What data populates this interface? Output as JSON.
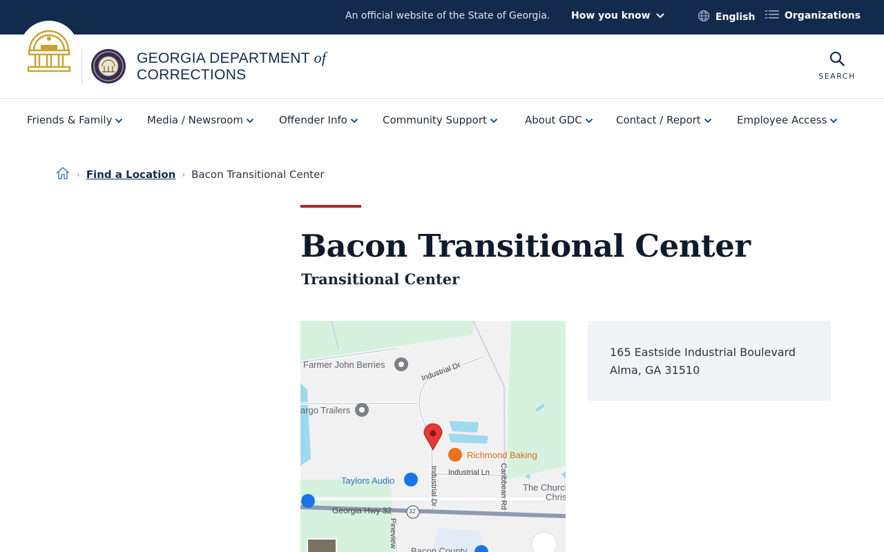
{
  "gov_banner": {
    "official_text": "An official website of the State of Georgia.",
    "how_you_know": "How you know",
    "language": "English",
    "organizations": "Organizations"
  },
  "header": {
    "agency_line1": "GEORGIA DEPARTMENT",
    "agency_of": "of",
    "agency_line2": "CORRECTIONS",
    "search_label": "SEARCH"
  },
  "nav": {
    "items": [
      {
        "label": "Friends & Family"
      },
      {
        "label": "Media / Newsroom"
      },
      {
        "label": "Offender Info"
      },
      {
        "label": "Community Support"
      },
      {
        "label": "About GDC"
      },
      {
        "label": "Contact / Report"
      },
      {
        "label": "Employee Access"
      }
    ]
  },
  "breadcrumb": {
    "link": "Find a Location",
    "current": "Bacon Transitional Center"
  },
  "page": {
    "title": "Bacon Transitional Center",
    "subtitle": "Transitional Center"
  },
  "address": {
    "line1": "165 Eastside Industrial Boulevard",
    "line2": "Alma, GA 31510"
  },
  "map": {
    "pois": {
      "farmer": "Farmer John Berries",
      "cargo": "argo Trailers",
      "richmond": "Richmond Baking",
      "taylors": "Taylors Audio",
      "church": "The Church",
      "church2": "Christ",
      "bacon_county": "Bacon County"
    },
    "roads": {
      "industrial_dr_top": "Industrial Dr",
      "industrial_dr_v": "Industrial Dr",
      "industrial_ln": "Industrial Ln",
      "caribbean": "Caribbean Rd",
      "hwy": "Georgia Hwy 32",
      "hwy_shield": "32",
      "pineview": "Pineview"
    },
    "colors": {
      "park": "#d6f2df",
      "water": "#9fd9ee",
      "highway": "#8c9bb2",
      "marker": "#e53935"
    }
  },
  "colors": {
    "navy": "#122b4c",
    "accent_red": "#b1232b",
    "gold": "#c9a227"
  }
}
